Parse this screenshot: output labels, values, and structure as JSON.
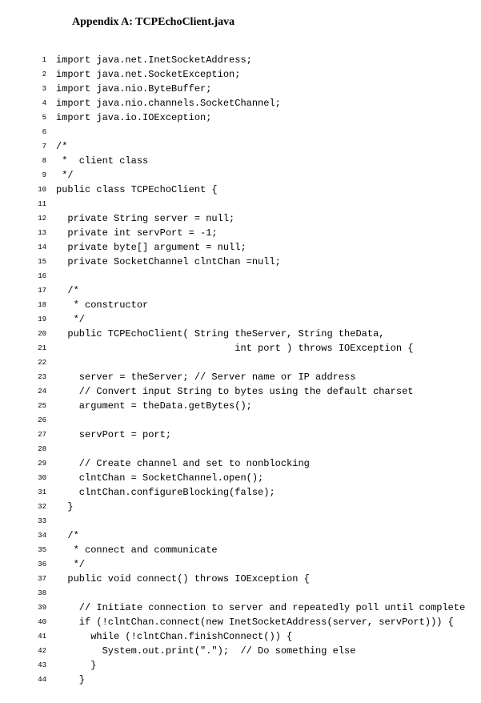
{
  "appendix_title": "Appendix A: TCPEchoClient.java",
  "code_lines": [
    "import java.net.InetSocketAddress;",
    "import java.net.SocketException;",
    "import java.nio.ByteBuffer;",
    "import java.nio.channels.SocketChannel;",
    "import java.io.IOException;",
    "",
    "/*",
    " *  client class",
    " */",
    "public class TCPEchoClient {",
    "",
    "  private String server = null;",
    "  private int servPort = -1;",
    "  private byte[] argument = null;",
    "  private SocketChannel clntChan =null;",
    "",
    "  /*",
    "   * constructor",
    "   */",
    "  public TCPEchoClient( String theServer, String theData,",
    "                               int port ) throws IOException {",
    "",
    "    server = theServer; // Server name or IP address",
    "    // Convert input String to bytes using the default charset",
    "    argument = theData.getBytes();",
    "",
    "    servPort = port;",
    "",
    "    // Create channel and set to nonblocking",
    "    clntChan = SocketChannel.open();",
    "    clntChan.configureBlocking(false);",
    "  }",
    "",
    "  /*",
    "   * connect and communicate",
    "   */",
    "  public void connect() throws IOException {",
    "",
    "    // Initiate connection to server and repeatedly poll until complete",
    "    if (!clntChan.connect(new InetSocketAddress(server, servPort))) {",
    "      while (!clntChan.finishConnect()) {",
    "        System.out.print(\".\");  // Do something else",
    "      }",
    "    }"
  ]
}
